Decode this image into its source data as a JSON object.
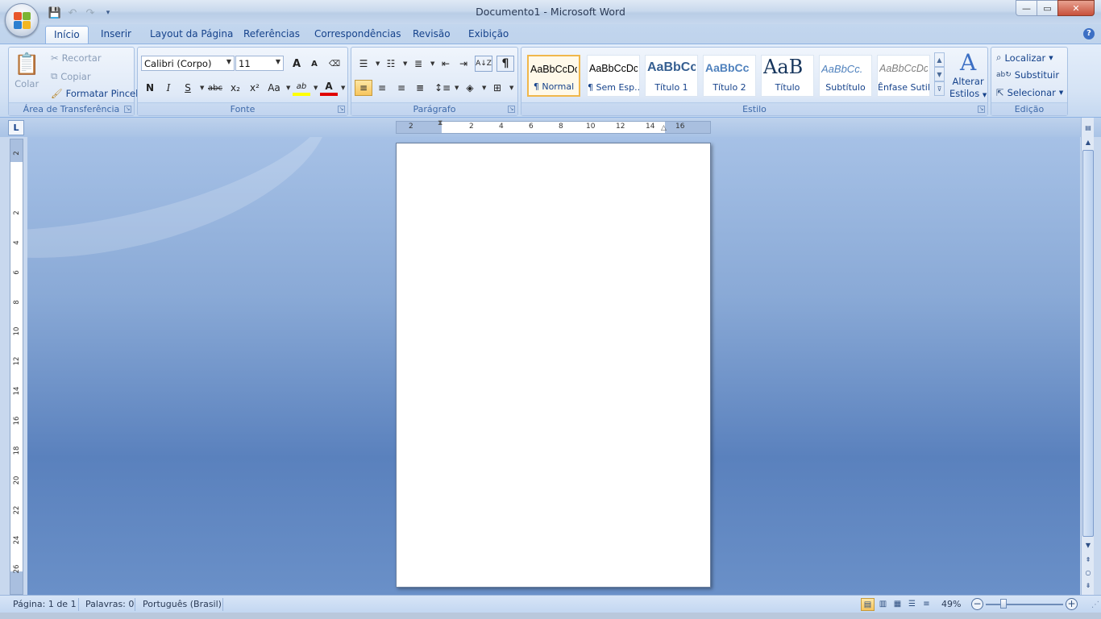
{
  "window": {
    "title": "Documento1 - Microsoft Word",
    "controls": {
      "minimize": "—",
      "maximize": "▭",
      "close": "✕"
    }
  },
  "quick_access": [
    "save-icon",
    "undo-icon",
    "redo-icon",
    "customize-icon"
  ],
  "tabs": [
    {
      "label": "Início",
      "active": true
    },
    {
      "label": "Inserir"
    },
    {
      "label": "Layout da Página"
    },
    {
      "label": "Referências"
    },
    {
      "label": "Correspondências"
    },
    {
      "label": "Revisão"
    },
    {
      "label": "Exibição"
    }
  ],
  "help_label": "?",
  "clipboard": {
    "label": "Área de Transferência",
    "paste": "Colar",
    "cut": "Recortar",
    "copy": "Copiar",
    "format_painter": "Formatar Pincel"
  },
  "font": {
    "label": "Fonte",
    "family": "Calibri (Corpo)",
    "size": "11",
    "grow": "A",
    "shrink": "A",
    "bold": "N",
    "italic": "I",
    "underline": "S",
    "strike": "abc",
    "subscript": "x₂",
    "superscript": "x²",
    "change_case": "Aa",
    "highlight": "ab",
    "font_color": "A"
  },
  "paragraph": {
    "label": "Parágrafo",
    "pilcrow": "¶",
    "sort": "A↓Z"
  },
  "styles": {
    "label": "Estilo",
    "items": [
      {
        "sample": "AaBbCcDc",
        "name": "¶ Normal",
        "selected": true
      },
      {
        "sample": "AaBbCcDc",
        "name": "¶ Sem Esp..."
      },
      {
        "sample": "AaBbCc",
        "name": "Título 1"
      },
      {
        "sample": "AaBbCc",
        "name": "Título 2"
      },
      {
        "sample": "AaB",
        "name": "Título"
      },
      {
        "sample": "AaBbCc.",
        "name": "Subtítulo"
      },
      {
        "sample": "AaBbCcDc",
        "name": "Ênfase Sutil"
      }
    ],
    "change_styles_line1": "Alterar",
    "change_styles_line2": "Estilos",
    "change_glyph": "A"
  },
  "editing": {
    "label": "Edição",
    "find": "Localizar",
    "replace": "Substituir",
    "select": "Selecionar"
  },
  "ruler": {
    "tab_selector": "L",
    "h_numbers": [
      "2",
      "2",
      "4",
      "6",
      "8",
      "10",
      "12",
      "14",
      "16"
    ],
    "v_numbers": [
      "2",
      "2",
      "4",
      "6",
      "8",
      "10",
      "12",
      "14",
      "16",
      "18",
      "20",
      "22",
      "24",
      "26"
    ]
  },
  "status": {
    "page": "Página: 1 de 1",
    "words": "Palavras: 0",
    "language": "Português (Brasil)",
    "zoom": "49%",
    "zoom_out": "−",
    "zoom_in": "+"
  },
  "colors": {
    "accent": "#15428b",
    "ribbon_border": "#8db2e3",
    "selected_style": "#f0b74b",
    "workspace": "#5a81bd"
  }
}
